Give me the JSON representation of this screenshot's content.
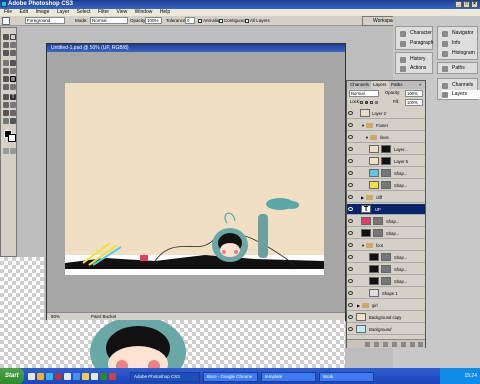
{
  "app": {
    "title": "Adobe Photoshop CS3"
  },
  "menu": [
    "File",
    "Edit",
    "Image",
    "Layer",
    "Select",
    "Filter",
    "View",
    "Window",
    "Help"
  ],
  "options": {
    "fill_value": "Foreground",
    "mode_label": "Mode:",
    "mode_value": "Normal",
    "opacity_label": "Opacity:",
    "opacity_value": "100%",
    "tolerance_label": "Tolerance:",
    "tolerance_value": "0",
    "antialias_label": "Anti-alias",
    "contiguous_label": "Contiguous",
    "alllayers_label": "All Layers",
    "workspace_label": "Workspace"
  },
  "document": {
    "title": "Untitled-1.psd @ 50% (UP, RGB/8)",
    "zoom": "50%",
    "tool_status": "Paint Bucket"
  },
  "dock": {
    "group1": [
      "Character",
      "Paragraph"
    ],
    "group2": [
      "Navigator",
      "Info",
      "Histogram"
    ],
    "group3": [
      "History",
      "Actions"
    ],
    "group4": [
      "Paths"
    ],
    "group5": [
      "Channels",
      "Layers"
    ]
  },
  "layers_panel": {
    "tabs": [
      "Channels",
      "Layers",
      "Paths"
    ],
    "blend_mode": "Normal",
    "opacity_label": "Opacity:",
    "opacity_value": "100%",
    "lock_label": "Lock:",
    "fill_label": "Fill:",
    "fill_value": "100%",
    "rows": [
      {
        "name": "Layer 2",
        "type": "layer"
      },
      {
        "name": "Footer",
        "type": "group"
      },
      {
        "name": "lines",
        "type": "group"
      },
      {
        "name": "Layer...",
        "type": "layer"
      },
      {
        "name": "Layer 5",
        "type": "layer"
      },
      {
        "name": "Shap...",
        "type": "shape"
      },
      {
        "name": "Shap...",
        "type": "shape"
      },
      {
        "name": "cliff",
        "type": "group"
      },
      {
        "name": "UP",
        "type": "text"
      },
      {
        "name": "Shap...",
        "type": "shape"
      },
      {
        "name": "Shap...",
        "type": "shape"
      },
      {
        "name": "foot",
        "type": "group"
      },
      {
        "name": "Shap...",
        "type": "shape"
      },
      {
        "name": "Shap...",
        "type": "shape"
      },
      {
        "name": "Shap...",
        "type": "shape"
      },
      {
        "name": "Shape 1",
        "type": "shape"
      },
      {
        "name": "girl",
        "type": "group"
      },
      {
        "name": "Background copy",
        "type": "layer"
      },
      {
        "name": "Background",
        "type": "layer"
      }
    ]
  },
  "taskbar": {
    "start": "Start",
    "tasks": [
      "Adobe Photoshop CS3",
      "Boro - Google Chrome",
      "template",
      "Work"
    ],
    "clock": "15:24"
  },
  "colors": {
    "canvas_bg": "#f1dfc3",
    "teal": "#5aa8a8",
    "selection": "#0a246a",
    "taskbar": "#245edb"
  }
}
